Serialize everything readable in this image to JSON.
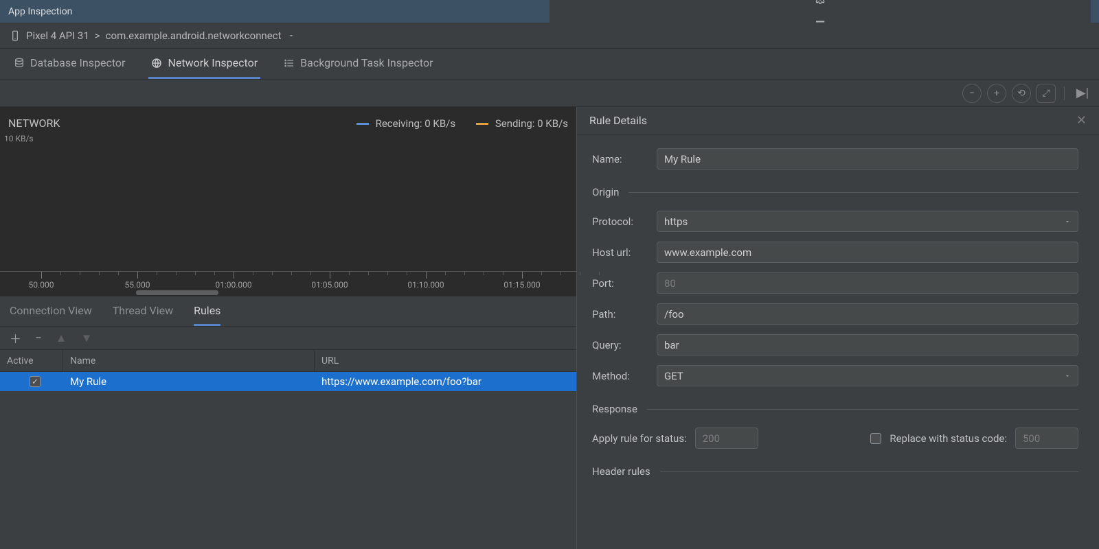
{
  "titlebar": {
    "title": "App Inspection"
  },
  "breadcrumb": {
    "device": "Pixel 4 API 31",
    "separator": ">",
    "app": "com.example.android.networkconnect"
  },
  "inspectorTabs": {
    "database": "Database Inspector",
    "network": "Network Inspector",
    "background": "Background Task Inspector",
    "active": "network"
  },
  "network": {
    "title": "NETWORK",
    "yScaleLabel": "10 KB/s",
    "legend": {
      "receiving_label": "Receiving:",
      "receiving_value": "0 KB/s",
      "sending_label": "Sending:",
      "sending_value": "0 KB/s",
      "receiving_color": "#5b8ed6",
      "sending_color": "#e0a13d"
    },
    "timeline": [
      "50.000",
      "55.000",
      "01:00.000",
      "01:05.000",
      "01:10.000",
      "01:15.000"
    ]
  },
  "subtabs": {
    "connection": "Connection View",
    "thread": "Thread View",
    "rules": "Rules",
    "active": "rules"
  },
  "rulesTable": {
    "headers": {
      "active": "Active",
      "name": "Name",
      "url": "URL"
    },
    "rows": [
      {
        "active": true,
        "name": "My Rule",
        "url": "https://www.example.com/foo?bar"
      }
    ]
  },
  "details": {
    "title": "Rule Details",
    "name_label": "Name:",
    "name_value": "My Rule",
    "origin_section": "Origin",
    "protocol_label": "Protocol:",
    "protocol_value": "https",
    "host_label": "Host url:",
    "host_value": "www.example.com",
    "port_label": "Port:",
    "port_placeholder": "80",
    "path_label": "Path:",
    "path_value": "/foo",
    "query_label": "Query:",
    "query_value": "bar",
    "method_label": "Method:",
    "method_value": "GET",
    "response_section": "Response",
    "apply_label": "Apply rule for status:",
    "apply_placeholder": "200",
    "replace_label": "Replace with status code:",
    "replace_placeholder": "500",
    "header_rules_section": "Header rules"
  }
}
